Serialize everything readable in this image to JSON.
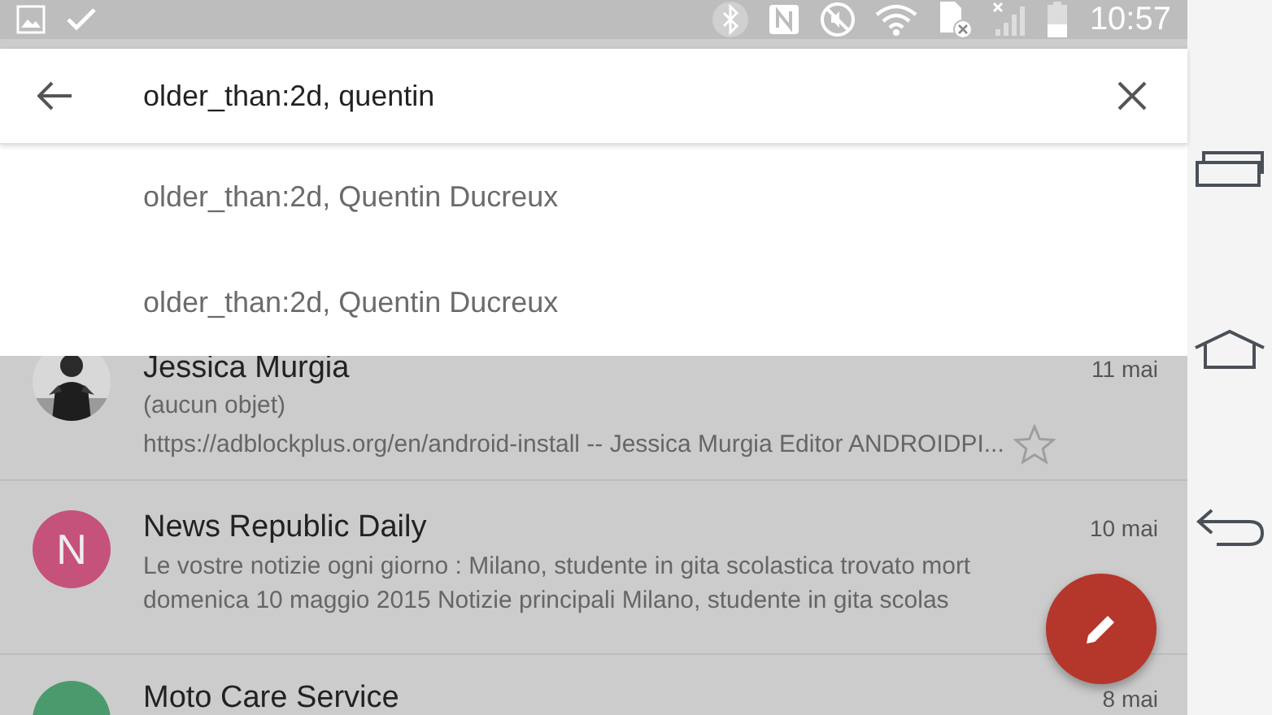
{
  "status_bar": {
    "time": "10:57"
  },
  "search": {
    "value": "older_than:2d, quentin"
  },
  "suggestions": [
    {
      "text": "older_than:2d, Quentin Ducreux"
    },
    {
      "text": "older_than:2d, Quentin Ducreux"
    }
  ],
  "messages": [
    {
      "sender": "Jessica Murgia",
      "date": "11 mai",
      "avatar": {
        "kind": "picture"
      },
      "lines": [
        "(aucun objet)",
        "https://adblockplus.org/en/android-install -- Jessica Murgia Editor ANDROIDPI..."
      ],
      "starred": false
    },
    {
      "sender": "News Republic Daily",
      "date": "10 mai",
      "avatar": {
        "kind": "letter",
        "letter": "N",
        "color": "#c4527a"
      },
      "lines": [
        "Le vostre notizie ogni giorno : Milano, studente in gita scolastica trovato mort",
        "domenica 10 maggio 2015 Notizie principali Milano, studente in gita scolas"
      ]
    },
    {
      "sender": "Moto Care Service",
      "date": "8 mai",
      "avatar": {
        "kind": "letter",
        "color": "#4a9a6e"
      }
    }
  ]
}
